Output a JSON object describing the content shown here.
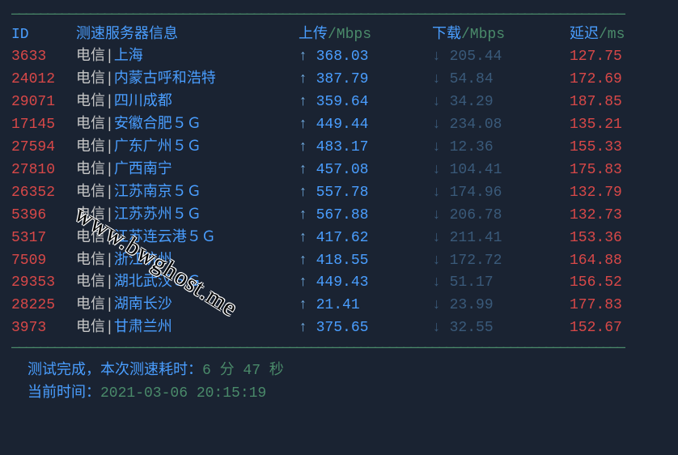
{
  "headers": {
    "id": "ID",
    "server": "测速服务器信息",
    "upload_label": "上传",
    "upload_unit": "/Mbps",
    "download_label": "下载",
    "download_unit": "/Mbps",
    "latency_label": "延迟",
    "latency_unit": "/ms"
  },
  "rows": [
    {
      "id": "3633",
      "isp": "电信",
      "location": "上海",
      "upload": "368.03",
      "download": "205.44",
      "latency": "127.75"
    },
    {
      "id": "24012",
      "isp": "电信",
      "location": "内蒙古呼和浩特",
      "upload": "387.79",
      "download": "54.84",
      "latency": "172.69"
    },
    {
      "id": "29071",
      "isp": "电信",
      "location": "四川成都",
      "upload": "359.64",
      "download": "34.29",
      "latency": "187.85"
    },
    {
      "id": "17145",
      "isp": "电信",
      "location": "安徽合肥５Ｇ",
      "upload": "449.44",
      "download": "234.08",
      "latency": "135.21"
    },
    {
      "id": "27594",
      "isp": "电信",
      "location": "广东广州５Ｇ",
      "upload": "483.17",
      "download": "12.36",
      "latency": "155.33"
    },
    {
      "id": "27810",
      "isp": "电信",
      "location": "广西南宁",
      "upload": "457.08",
      "download": "104.41",
      "latency": "175.83"
    },
    {
      "id": "26352",
      "isp": "电信",
      "location": "江苏南京５Ｇ",
      "upload": "557.78",
      "download": "174.96",
      "latency": "132.79"
    },
    {
      "id": "5396",
      "isp": "电信",
      "location": "江苏苏州５Ｇ",
      "upload": "567.88",
      "download": "206.78",
      "latency": "132.73"
    },
    {
      "id": "5317",
      "isp": "电信",
      "location": "江苏连云港５Ｇ",
      "upload": "417.62",
      "download": "211.41",
      "latency": "153.36"
    },
    {
      "id": "7509",
      "isp": "电信",
      "location": "浙江杭州",
      "upload": "418.55",
      "download": "172.72",
      "latency": "164.88"
    },
    {
      "id": "29353",
      "isp": "电信",
      "location": "湖北武汉５Ｇ",
      "upload": "449.43",
      "download": "51.17",
      "latency": "156.52"
    },
    {
      "id": "28225",
      "isp": "电信",
      "location": "湖南长沙",
      "upload": "21.41",
      "download": "23.99",
      "latency": "177.83"
    },
    {
      "id": "3973",
      "isp": "电信",
      "location": "甘肃兰州",
      "upload": "375.65",
      "download": "32.55",
      "latency": "152.67"
    }
  ],
  "arrows": {
    "up": "↑",
    "down": "↓"
  },
  "separator": "|",
  "hr": "——————————————————————————————————————————————————————————————————————————————————————",
  "footer": {
    "line1_prefix": "测试完成，本次测速耗时：",
    "line1_value": "6 分 47 秒",
    "line2_prefix": "当前时间：",
    "line2_value": "2021-03-06 20:15:19"
  },
  "watermark": "www.bwghost.me"
}
